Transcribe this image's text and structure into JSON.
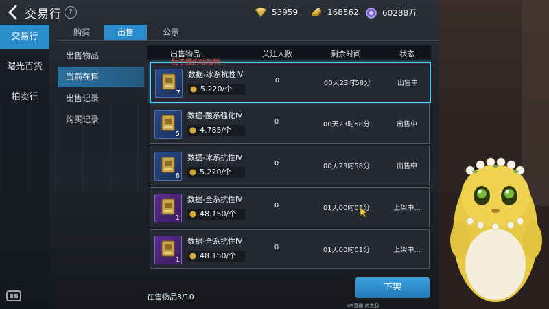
{
  "header": {
    "title": "交易行",
    "help": "?",
    "currencies": [
      {
        "icon": "gem-icon",
        "value": "53959"
      },
      {
        "icon": "gold-bar-icon",
        "value": "168562"
      },
      {
        "icon": "coin-bag-icon",
        "value": "60288万"
      }
    ]
  },
  "sidebar": {
    "items": [
      {
        "label": "交易行",
        "active": true
      },
      {
        "label": "曙光百货",
        "active": false
      },
      {
        "label": "拍卖行",
        "active": false
      }
    ]
  },
  "tabs": [
    {
      "label": "购买",
      "active": false
    },
    {
      "label": "出售",
      "active": true
    },
    {
      "label": "公示",
      "active": false
    }
  ],
  "submenu": [
    {
      "label": "出售物品",
      "active": false
    },
    {
      "label": "当前在售",
      "active": true
    },
    {
      "label": "出售记录",
      "active": false
    },
    {
      "label": "购买记录",
      "active": false
    }
  ],
  "table": {
    "headers": [
      "出售物品",
      "关注人数",
      "剩余时间",
      "状态"
    ],
    "rows": [
      {
        "name": "数据-冰系抗性Ⅳ",
        "qty": "7",
        "price": "5.220/个",
        "watchers": "0",
        "remaining": "00天23时58分",
        "status": "出售中",
        "rarity": "blue",
        "selected": true
      },
      {
        "name": "数据-酸系强化Ⅳ",
        "qty": "5",
        "price": "4.785/个",
        "watchers": "0",
        "remaining": "00天23时58分",
        "status": "出售中",
        "rarity": "blue",
        "selected": false
      },
      {
        "name": "数据-冰系抗性Ⅳ",
        "qty": "6",
        "price": "5.220/个",
        "watchers": "0",
        "remaining": "00天23时58分",
        "status": "出售中",
        "rarity": "blue",
        "selected": false
      },
      {
        "name": "数据-全系抗性Ⅳ",
        "qty": "1",
        "price": "48.150/个",
        "watchers": "0",
        "remaining": "01天00时01分",
        "status": "上架中...",
        "rarity": "purple",
        "selected": false
      },
      {
        "name": "数据-全系抗性Ⅳ",
        "qty": "1",
        "price": "48.150/个",
        "watchers": "0",
        "remaining": "01天00时01分",
        "status": "上架中...",
        "rarity": "purple",
        "selected": false
      }
    ]
  },
  "overlay_watermark": "肚子饿的咕咕咧~",
  "footer": {
    "count_text": "在售物品8/10",
    "delist_button": "下架",
    "stream_id": "DY直播|尚太极 ID:156387742832905124"
  },
  "colors": {
    "accent": "#2b8ccc",
    "selected_border": "#4fd0e6",
    "watermark": "#ff4d4d"
  }
}
